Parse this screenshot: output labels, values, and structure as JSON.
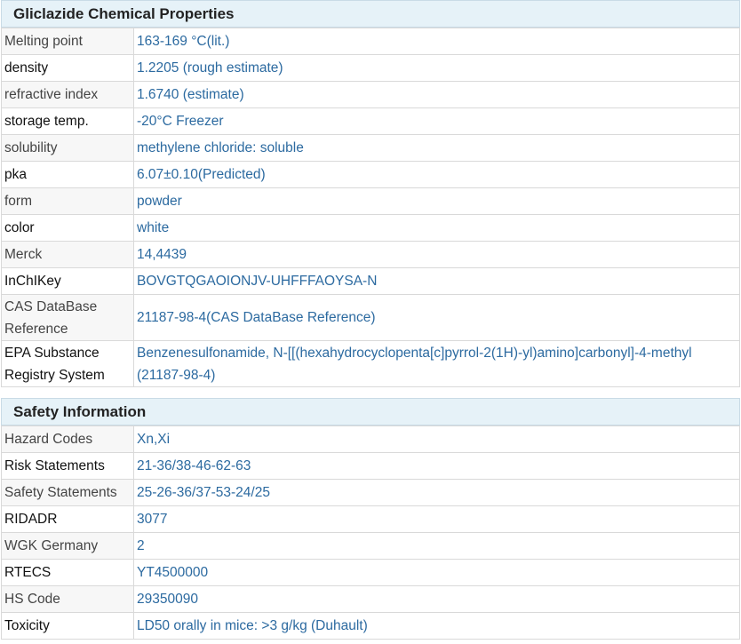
{
  "chemical_properties": {
    "title": "Gliclazide Chemical Properties",
    "rows": [
      {
        "label": "Melting point",
        "value": "163-169 °C(lit.)"
      },
      {
        "label": "density",
        "value": "1.2205 (rough estimate)"
      },
      {
        "label": "refractive index",
        "value": "1.6740 (estimate)"
      },
      {
        "label": "storage temp.",
        "value": "-20°C Freezer"
      },
      {
        "label": "solubility",
        "value": "methylene chloride: soluble"
      },
      {
        "label": "pka",
        "value": "6.07±0.10(Predicted)"
      },
      {
        "label": "form",
        "value": "powder"
      },
      {
        "label": "color",
        "value": "white"
      },
      {
        "label": "Merck",
        "value": "14,4439"
      },
      {
        "label": "InChIKey",
        "value": "BOVGTQGAOIONJV-UHFFFAOYSA-N"
      },
      {
        "label": "CAS DataBase Reference",
        "value": "21187-98-4(CAS DataBase Reference)"
      },
      {
        "label": "EPA Substance Registry System",
        "value": "Benzenesulfonamide, N-[[(hexahydrocyclopenta[c]pyrrol-2(1H)-yl)amino]carbonyl]-4-methyl (21187-98-4)"
      }
    ]
  },
  "safety_information": {
    "title": "Safety Information",
    "rows": [
      {
        "label": "Hazard Codes",
        "value": "Xn,Xi"
      },
      {
        "label": "Risk Statements",
        "value": "21-36/38-46-62-63"
      },
      {
        "label": "Safety Statements",
        "value": "25-26-36/37-53-24/25"
      },
      {
        "label": "RIDADR",
        "value": "3077"
      },
      {
        "label": "WGK Germany",
        "value": "2"
      },
      {
        "label": "RTECS",
        "value": "YT4500000"
      },
      {
        "label": "HS Code",
        "value": "29350090"
      },
      {
        "label": "Toxicity",
        "value": "LD50 orally in mice: >3 g/kg (Duhault)"
      }
    ]
  }
}
